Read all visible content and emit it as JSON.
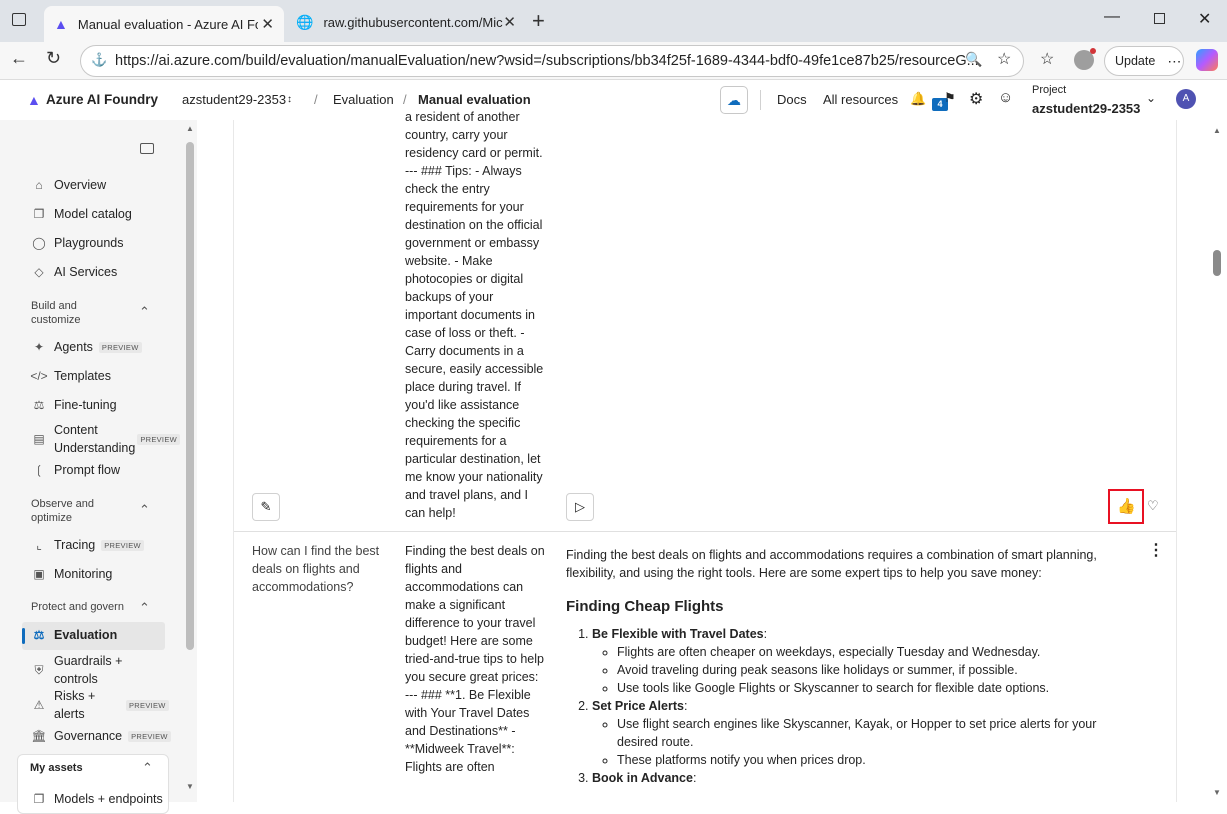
{
  "browser": {
    "tabs": [
      {
        "title": "Manual evaluation - Azure AI Fou"
      },
      {
        "title": "raw.githubusercontent.com/Micro"
      }
    ],
    "url": "https://ai.azure.com/build/evaluation/manualEvaluation/new?wsid=/subscriptions/bb34f25f-1689-4344-bdf0-49fe1ce87b25/resourceG...",
    "update_label": "Update"
  },
  "header": {
    "brand": "Azure AI Foundry",
    "project_crumb": "azstudent29-2353",
    "crumb_evaluation": "Evaluation",
    "crumb_current": "Manual evaluation",
    "docs": "Docs",
    "all_resources": "All resources",
    "notif_count": "4",
    "project_label": "Project",
    "project_name": "azstudent29-2353",
    "avatar": "A"
  },
  "sidebar": {
    "items_top": [
      "Overview",
      "Model catalog",
      "Playgrounds",
      "AI Services"
    ],
    "section_build": "Build and\ncustomize",
    "items_build": [
      "Agents",
      "Templates",
      "Fine-tuning",
      "Content\nUnderstanding",
      "Prompt flow"
    ],
    "section_observe": "Observe and\noptimize",
    "items_observe": [
      "Tracing",
      "Monitoring"
    ],
    "section_protect": "Protect and govern",
    "items_protect": [
      "Evaluation",
      "Guardrails +\ncontrols",
      "Risks +\nalerts",
      "Governance"
    ],
    "my_assets": "My assets",
    "models": "Models + endpoints",
    "preview_tag": "PREVIEW"
  },
  "rows": {
    "row1_response": "a resident of another country, carry your residency card or permit. --- ### Tips: - Always check the entry requirements for your destination on the official government or embassy website. - Make photocopies or digital backups of your important documents in case of loss or theft. - Carry documents in a secure, easily accessible place during travel. If you'd like assistance checking the specific requirements for a particular destination, let me know your nationality and travel plans, and I can help!",
    "row2_question": "How can I find the best deals on flights and accommodations?",
    "row2_response": "Finding the best deals on flights and accommodations can make a significant difference to your travel budget! Here are some tried-and-true tips to help you secure great prices: --- ### **1. Be Flexible with Your Travel Dates and Destinations** - **Midweek Travel**: Flights are often",
    "row2_output_intro": "Finding the best deals on flights and accommodations requires a combination of smart planning, flexibility, and using the right tools. Here are some expert tips to help you save money:",
    "row2_output_heading": "Finding Cheap Flights",
    "tips": [
      {
        "title": "Be Flexible with Travel Dates",
        "bullets": [
          "Flights are often cheaper on weekdays, especially Tuesday and Wednesday.",
          "Avoid traveling during peak seasons like holidays or summer, if possible.",
          "Use tools like Google Flights or Skyscanner to search for flexible date options."
        ]
      },
      {
        "title": "Set Price Alerts",
        "bullets": [
          "Use flight search engines like Skyscanner, Kayak, or Hopper to set price alerts for your desired route.",
          "These platforms notify you when prices drop."
        ]
      },
      {
        "title": "Book in Advance",
        "bullets": []
      }
    ]
  }
}
